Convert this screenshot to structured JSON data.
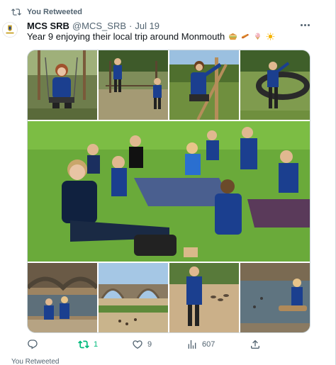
{
  "retweet_banner": {
    "label": "You Retweeted",
    "icon": "retweet-icon"
  },
  "author": {
    "name": "MCS SRB",
    "handle": "@MCS_SRB",
    "separator": "·",
    "date": "Jul 19"
  },
  "tweet": {
    "text": "Year 9 enjoying their local trip around Monmouth",
    "emojis": [
      "sandwich-emoji",
      "hotdog-emoji",
      "ice-cream-emoji",
      "sun-emoji"
    ]
  },
  "media": {
    "photos": [
      "photo-swing-student",
      "photo-playground-students",
      "photo-student-climbing-frame",
      "photo-student-nest-swing",
      "photo-group-picnic",
      "photo-riverside-bridge",
      "photo-student-feeding-ducks",
      "photo-students-at-river"
    ]
  },
  "actions": {
    "reply": {
      "icon": "reply-icon",
      "count": ""
    },
    "retweet": {
      "icon": "retweet-icon",
      "count": "1",
      "color": "#00ba7c"
    },
    "like": {
      "icon": "heart-icon",
      "count": "9"
    },
    "views": {
      "icon": "views-icon",
      "count": "607"
    },
    "share": {
      "icon": "share-icon",
      "count": ""
    }
  },
  "next_item": {
    "label": "You Retweeted"
  },
  "colors": {
    "secondary_text": "#536471",
    "primary_text": "#0f1419",
    "retweet_green": "#00ba7c",
    "border": "#cfd9de"
  }
}
